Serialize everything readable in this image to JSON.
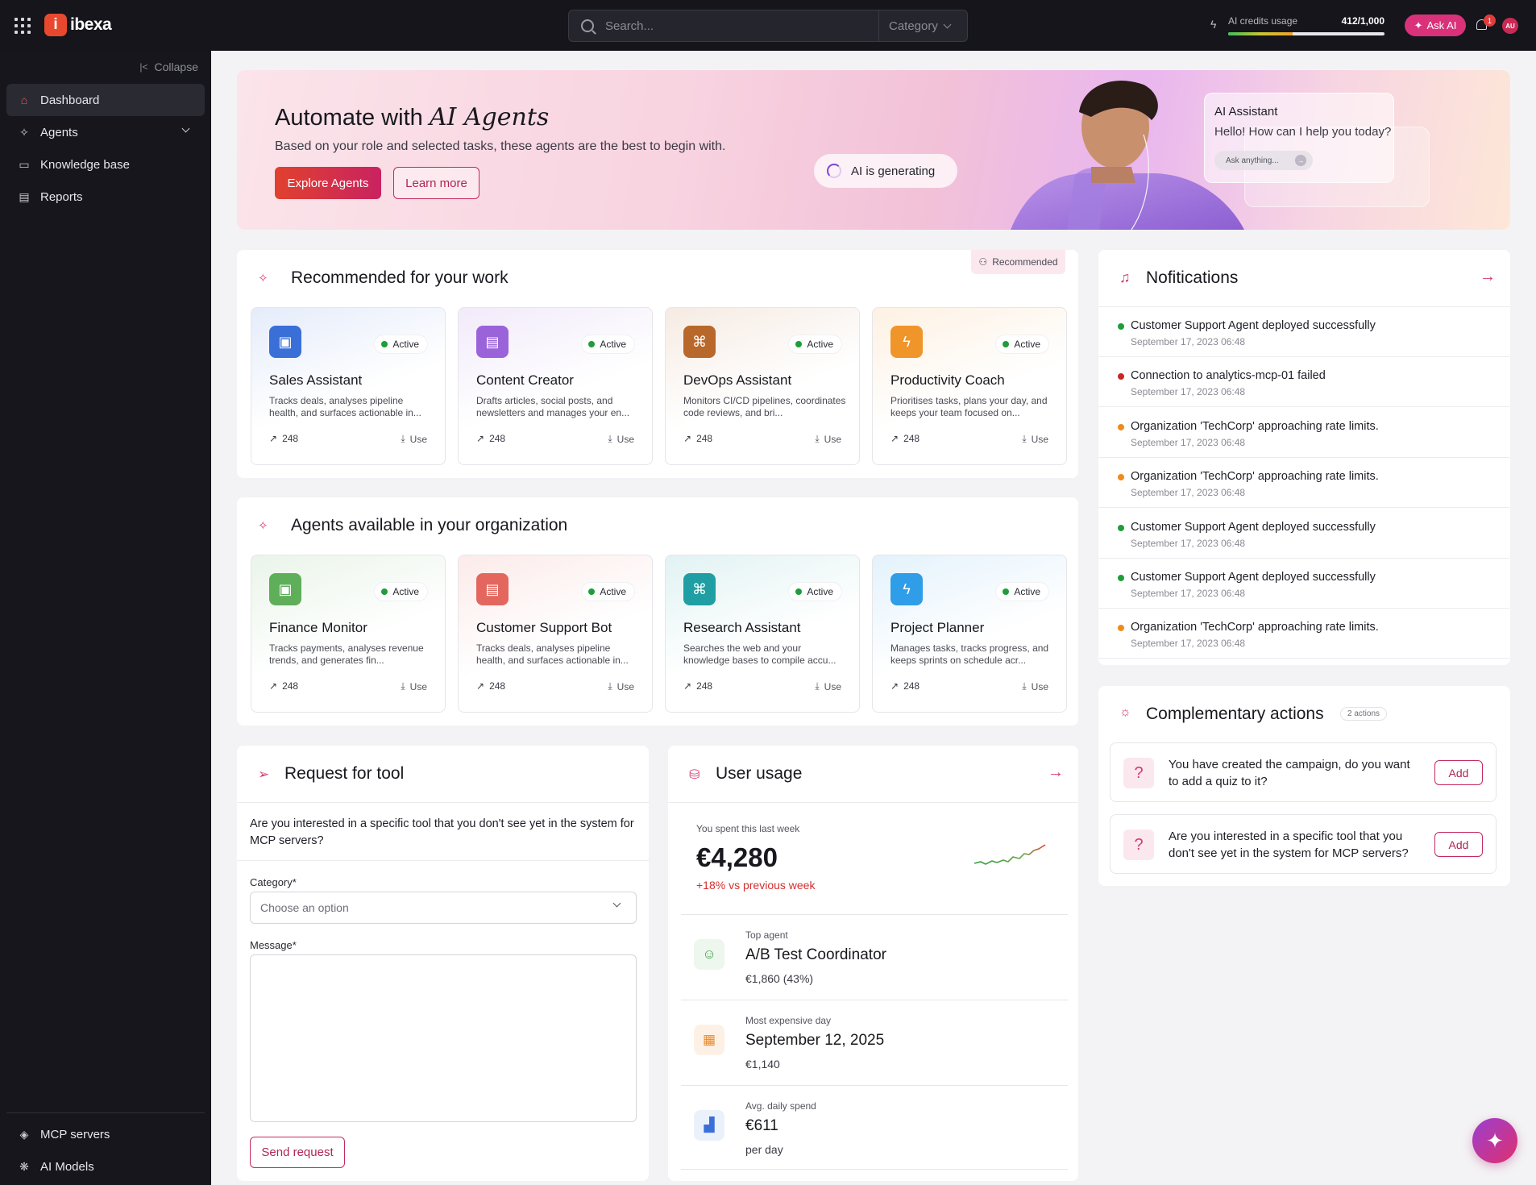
{
  "topbar": {
    "logo_mark": "i",
    "logo_text": "ibexa",
    "search_placeholder": "Search...",
    "category_label": "Category",
    "credits_label": "AI credits usage",
    "credits_value": "412/1,000",
    "credits_fraction": 0.412,
    "ask_ai_label": "Ask AI",
    "notification_count": "1",
    "avatar_initials": "AU"
  },
  "sidebar": {
    "collapse_label": "Collapse",
    "items": [
      {
        "label": "Dashboard",
        "icon": "home-icon",
        "active": true
      },
      {
        "label": "Agents",
        "icon": "sparkle-icon"
      },
      {
        "label": "Knowledge base",
        "icon": "book-icon"
      },
      {
        "label": "Reports",
        "icon": "report-icon"
      }
    ],
    "bottom_items": [
      {
        "label": "MCP servers",
        "icon": "mcp-icon"
      },
      {
        "label": "AI Models",
        "icon": "model-icon"
      }
    ]
  },
  "hero": {
    "title_prefix": "Automate with",
    "title_highlight": "AI Agents",
    "subtitle": "Based on your role and selected tasks, these agents are the best to begin with.",
    "primary_button": "Explore Agents",
    "secondary_button": "Learn more",
    "generating_chip": "AI is generating",
    "assistant_title": "AI Assistant",
    "assistant_message": "Hello! How can I help you today?",
    "assistant_input": "Ask anything..."
  },
  "recommended": {
    "title": "Recommended for your work",
    "tag": "Recommended",
    "cards": [
      {
        "name": "Sales Assistant",
        "desc": "Tracks deals, analyses pipeline health, and surfaces actionable in...",
        "status": "Active",
        "count": "248",
        "use": "Use",
        "color": "#3b6fd8"
      },
      {
        "name": "Content Creator",
        "desc": "Drafts articles, social posts, and newsletters and manages your en...",
        "status": "Active",
        "count": "248",
        "use": "Use",
        "color": "#9b63d9"
      },
      {
        "name": "DevOps Assistant",
        "desc": "Monitors CI/CD pipelines, coordinates code reviews, and bri...",
        "status": "Active",
        "count": "248",
        "use": "Use",
        "color": "#b8682a"
      },
      {
        "name": "Productivity Coach",
        "desc": "Prioritises tasks, plans your day, and keeps your team focused on...",
        "status": "Active",
        "count": "248",
        "use": "Use",
        "color": "#f0952a"
      }
    ]
  },
  "organization": {
    "title": "Agents available in your organization",
    "cards": [
      {
        "name": "Finance Monitor",
        "desc": "Tracks payments, analyses revenue trends, and generates fin...",
        "status": "Active",
        "count": "248",
        "use": "Use",
        "color": "#5fae5a"
      },
      {
        "name": "Customer Support Bot",
        "desc": "Tracks deals, analyses pipeline health, and surfaces actionable in...",
        "status": "Active",
        "count": "248",
        "use": "Use",
        "color": "#e4675f"
      },
      {
        "name": "Research Assistant",
        "desc": "Searches the web and your knowledge bases to compile accu...",
        "status": "Active",
        "count": "248",
        "use": "Use",
        "color": "#1f9fa3"
      },
      {
        "name": "Project Planner",
        "desc": "Manages tasks, tracks progress, and keeps sprints on schedule acr...",
        "status": "Active",
        "count": "248",
        "use": "Use",
        "color": "#2f9de8"
      }
    ]
  },
  "notifications": {
    "title": "Nofitications",
    "items": [
      {
        "msg": "Customer Support Agent deployed successfully",
        "time": "September 17, 2023 06:48",
        "color": "#1f9d3a"
      },
      {
        "msg": "Connection to analytics-mcp-01 failed",
        "time": "September 17, 2023 06:48",
        "color": "#c62828"
      },
      {
        "msg": "Organization 'TechCorp' approaching rate limits.",
        "time": "September 17, 2023 06:48",
        "color": "#f08a1c"
      },
      {
        "msg": "Organization 'TechCorp' approaching rate limits.",
        "time": "September 17, 2023 06:48",
        "color": "#f08a1c"
      },
      {
        "msg": "Customer Support Agent deployed successfully",
        "time": "September 17, 2023 06:48",
        "color": "#1f9d3a"
      },
      {
        "msg": "Customer Support Agent deployed successfully",
        "time": "September 17, 2023 06:48",
        "color": "#1f9d3a"
      },
      {
        "msg": "Organization 'TechCorp' approaching rate limits.",
        "time": "September 17, 2023 06:48",
        "color": "#f08a1c"
      }
    ]
  },
  "complementary": {
    "title": "Complementary actions",
    "badge": "2 actions",
    "items": [
      {
        "text": "You have created the campaign, do you want to add a quiz to it?",
        "button": "Add"
      },
      {
        "text": "Are you interested in a specific tool that you don't see yet in the system for MCP servers?",
        "button": "Add"
      }
    ]
  },
  "request_tool": {
    "title": "Request for tool",
    "intro": "Are you interested in a specific tool that you don't see yet in the system for MCP servers?",
    "category_label": "Category*",
    "category_placeholder": "Choose an option",
    "message_label": "Message*",
    "message_value": "",
    "submit": "Send request"
  },
  "user_usage": {
    "title": "User usage",
    "spent_label": "You spent this last week",
    "spent_value": "€4,280",
    "change": "+18% vs previous week",
    "stats": [
      {
        "label": "Top agent",
        "value": "A/B Test Coordinator",
        "sub": "€1,860 (43%)"
      },
      {
        "label": "Most expensive day",
        "value": "September 12, 2025",
        "sub": "€1,140"
      },
      {
        "label": "Avg. daily spend",
        "value": "€611",
        "sub": "per day"
      }
    ]
  }
}
